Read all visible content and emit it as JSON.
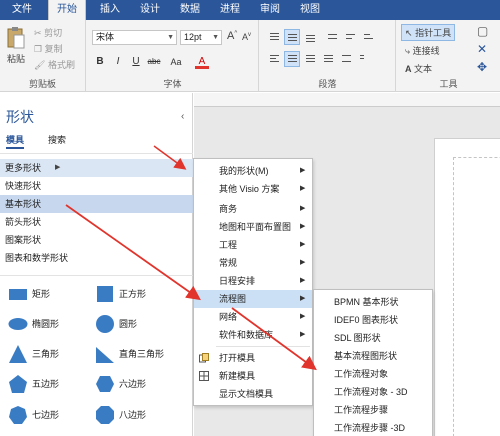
{
  "tabs": [
    "文件",
    "开始",
    "插入",
    "设计",
    "数据",
    "进程",
    "审阅",
    "视图"
  ],
  "ribbon": {
    "clipboard": {
      "paste": "粘贴",
      "cut": "剪切",
      "copy": "复制",
      "format_painter": "格式刷",
      "group_label": "剪贴板"
    },
    "font": {
      "font_name": "宋体",
      "font_size": "12pt",
      "grow": "A",
      "shrink": "A",
      "bold": "B",
      "italic": "I",
      "underline": "U",
      "strike": "abc",
      "case": "Aa",
      "color": "A",
      "group_label": "字体"
    },
    "paragraph": {
      "group_label": "段落"
    },
    "tools": {
      "pointer": "指针工具",
      "connector": "连接线",
      "text": "文本",
      "group_label": "工具"
    }
  },
  "pane": {
    "title": "形状",
    "tabs": [
      "模具",
      "搜索"
    ],
    "categories": [
      "更多形状",
      "快速形状",
      "基本形状",
      "箭头形状",
      "图案形状",
      "图表和数学形状"
    ],
    "shapes": [
      "矩形",
      "正方形",
      "椭圆形",
      "圆形",
      "三角形",
      "直角三角形",
      "五边形",
      "六边形",
      "七边形",
      "八边形"
    ]
  },
  "menu1": {
    "items": [
      "我的形状(M)",
      "其他 Visio 方案",
      "商务",
      "地图和平面布置图",
      "工程",
      "常规",
      "日程安排",
      "流程图",
      "网络",
      "软件和数据库",
      "打开模具",
      "新建模具",
      "显示文档模具"
    ]
  },
  "menu2": {
    "items": [
      "BPMN 基本形状",
      "IDEF0 图表形状",
      "SDL 图形状",
      "基本流程图形状",
      "工作流程对象",
      "工作流程对象 - 3D",
      "工作流程步骤",
      "工作流程步骤 -3D"
    ]
  },
  "colors": {
    "accent": "#2b579a",
    "highlight": "#cce0f5",
    "shape_blue": "#3a7cc4",
    "arrow_red": "#e0342c"
  }
}
